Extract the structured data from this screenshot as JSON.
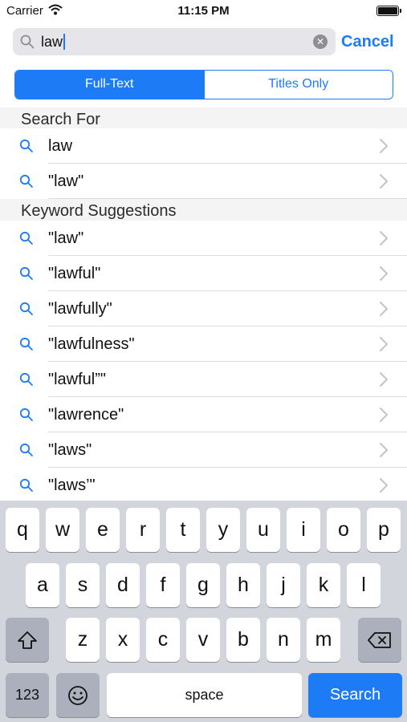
{
  "status_bar": {
    "carrier": "Carrier",
    "time": "11:15 PM"
  },
  "search": {
    "query": "law",
    "cancel_label": "Cancel"
  },
  "segments": {
    "full_text": "Full-Text",
    "titles_only": "Titles Only",
    "selected": "Full-Text"
  },
  "search_for": {
    "header": "Search For",
    "items": [
      {
        "label": "law"
      },
      {
        "label": "\"law\""
      }
    ]
  },
  "keyword_suggestions": {
    "header": "Keyword Suggestions",
    "items": [
      {
        "label": "\"law\""
      },
      {
        "label": "\"lawful\""
      },
      {
        "label": "\"lawfully\""
      },
      {
        "label": "\"lawfulness\""
      },
      {
        "label": "\"lawful”\""
      },
      {
        "label": "\"lawrence\""
      },
      {
        "label": "\"laws\""
      },
      {
        "label": "\"laws’\""
      }
    ]
  },
  "keyboard": {
    "row1": [
      "q",
      "w",
      "e",
      "r",
      "t",
      "y",
      "u",
      "i",
      "o",
      "p"
    ],
    "row2": [
      "a",
      "s",
      "d",
      "f",
      "g",
      "h",
      "j",
      "k",
      "l"
    ],
    "row3": [
      "z",
      "x",
      "c",
      "v",
      "b",
      "n",
      "m"
    ],
    "numbers_label": "123",
    "space_label": "space",
    "search_label": "Search"
  },
  "colors": {
    "accent": "#1d7bf5",
    "keyboard_bg": "#d2d5db",
    "dark_key": "#abb0bc"
  }
}
